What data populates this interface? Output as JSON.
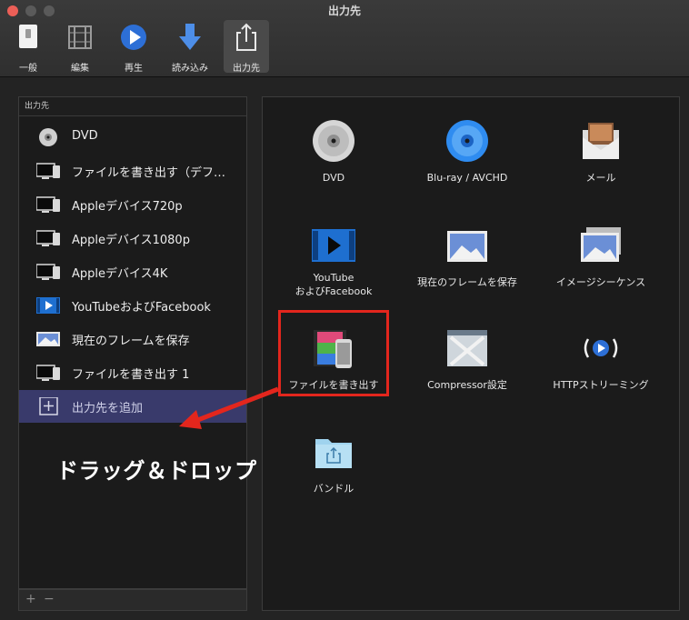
{
  "window": {
    "title": "出力先"
  },
  "toolbar": {
    "items": [
      {
        "label": "一般",
        "icon": "general-switch-icon"
      },
      {
        "label": "編集",
        "icon": "edit-film-icon"
      },
      {
        "label": "再生",
        "icon": "play-circle-icon"
      },
      {
        "label": "読み込み",
        "icon": "import-arrow-icon"
      },
      {
        "label": "出力先",
        "icon": "share-export-icon",
        "active": true
      }
    ]
  },
  "sidebar": {
    "header": "出力先",
    "items": [
      {
        "label": "DVD",
        "icon": "dvd-disc-icon"
      },
      {
        "label": "ファイルを書き出す（デフ…",
        "icon": "computer-monitor-icon"
      },
      {
        "label": "Appleデバイス720p",
        "icon": "computer-monitor-icon"
      },
      {
        "label": "Appleデバイス1080p",
        "icon": "computer-monitor-icon"
      },
      {
        "label": "Appleデバイス4K",
        "icon": "computer-monitor-icon"
      },
      {
        "label": "YouTubeおよびFacebook",
        "icon": "youtube-film-icon"
      },
      {
        "label": "現在のフレームを保存",
        "icon": "photo-frame-icon"
      },
      {
        "label": "ファイルを書き出す 1",
        "icon": "computer-monitor-icon"
      },
      {
        "label": "出力先を追加",
        "icon": "add-plus-icon",
        "selected": true
      }
    ],
    "footer": {
      "add": "+",
      "remove": "−"
    }
  },
  "destinations": {
    "items": [
      {
        "label": "DVD",
        "icon": "dvd-disc-icon"
      },
      {
        "label": "Blu-ray / AVCHD",
        "icon": "bluray-disc-icon"
      },
      {
        "label": "メール",
        "icon": "mail-envelope-icon"
      },
      {
        "label": "YouTube\nおよびFacebook",
        "icon": "youtube-film-icon"
      },
      {
        "label": "現在のフレームを保存",
        "icon": "photo-frame-icon"
      },
      {
        "label": "イメージシーケンス",
        "icon": "image-sequence-icon"
      },
      {
        "label": "ファイルを書き出す",
        "icon": "export-file-phone-icon"
      },
      {
        "label": "Compressor設定",
        "icon": "compressor-icon"
      },
      {
        "label": "HTTPストリーミング",
        "icon": "http-streaming-icon"
      },
      {
        "label": "バンドル",
        "icon": "bundle-folder-icon"
      }
    ]
  },
  "annotation": {
    "text": "ドラッグ＆ドロップ",
    "color": "#e3261d"
  },
  "colors": {
    "selection": "#393a6b",
    "highlight": "#e3261d",
    "accent": "#2d6fd6"
  }
}
